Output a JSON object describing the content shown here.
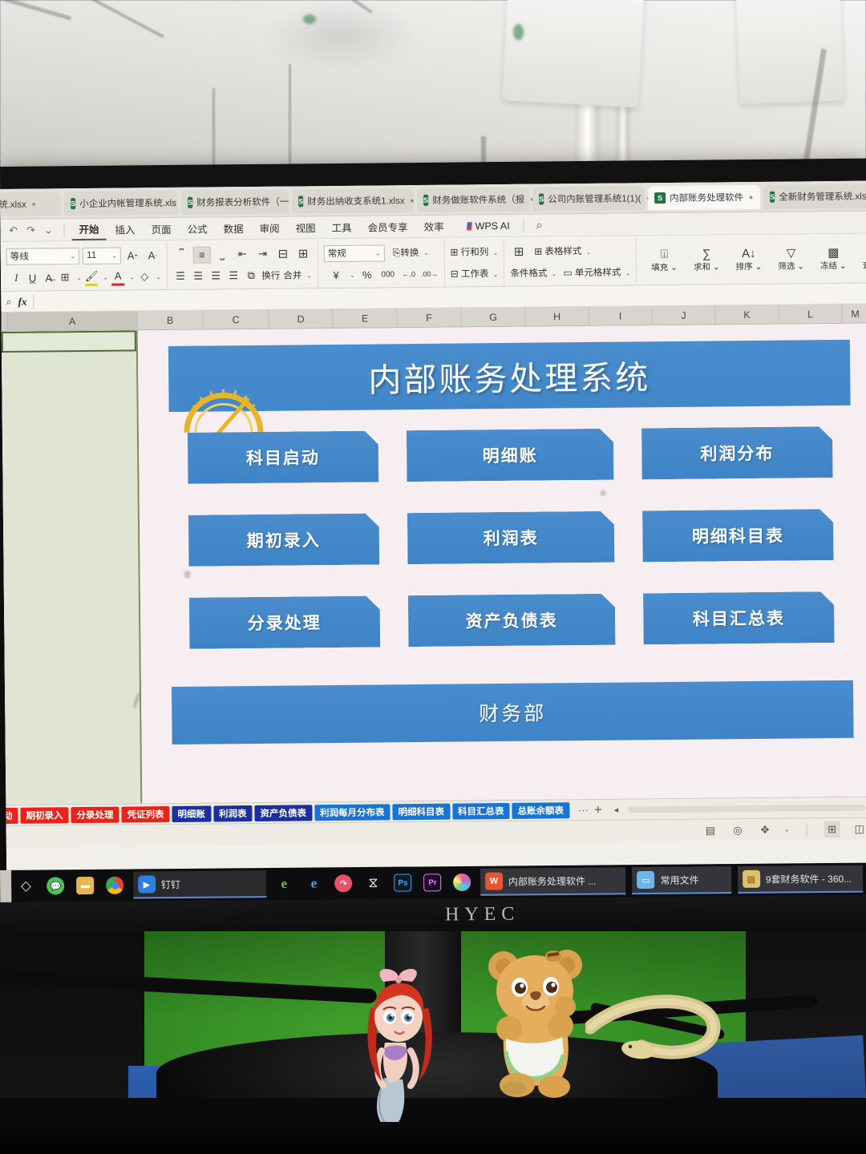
{
  "scene": {
    "monitor_brand": "HYEC",
    "photo_note": "photo of a monitor showing WPS Spreadsheet, toy figurines on desk"
  },
  "app": {
    "file_tabs": [
      {
        "label": "理系统.xlsx",
        "active": false,
        "icon": "excel-icon",
        "partial": true
      },
      {
        "label": "小企业内帐管理系统.xls",
        "active": false,
        "icon": "excel-icon"
      },
      {
        "label": "财务报表分析软件（一",
        "active": false,
        "icon": "excel-icon"
      },
      {
        "label": "财务出纳收支系统1.xlsx",
        "active": false,
        "icon": "excel-icon"
      },
      {
        "label": "财务做账软件系统（报",
        "active": false,
        "icon": "excel-icon"
      },
      {
        "label": "公司内账管理系统1(1)(",
        "active": false,
        "icon": "excel-icon"
      },
      {
        "label": "内部账务处理软件",
        "active": true,
        "icon": "excel-icon"
      },
      {
        "label": "全新财务管理系统.xlsm",
        "active": false,
        "icon": "excel-icon"
      }
    ],
    "menu": {
      "items": [
        {
          "label": "开始",
          "selected": true
        },
        {
          "label": "插入",
          "selected": false
        },
        {
          "label": "页面",
          "selected": false
        },
        {
          "label": "公式",
          "selected": false
        },
        {
          "label": "数据",
          "selected": false
        },
        {
          "label": "审阅",
          "selected": false
        },
        {
          "label": "视图",
          "selected": false
        },
        {
          "label": "工具",
          "selected": false
        },
        {
          "label": "会员专享",
          "selected": false
        },
        {
          "label": "效率",
          "selected": false
        }
      ],
      "ai_label": "WPS AI",
      "search_icon": "search-icon",
      "undo_icon": "undo-icon",
      "redo_icon": "redo-icon",
      "more_icon": "chevron-down-icon"
    },
    "ribbon": {
      "font": {
        "name": "等线",
        "size": "11",
        "grow_icon": "font-grow-icon",
        "shrink_icon": "font-shrink-icon"
      },
      "format_row2": [
        "italic-icon",
        "underline-icon",
        "strikethrough-icon",
        "borders-icon",
        "highlight-icon",
        "font-color-icon",
        "clear-format-icon"
      ],
      "align_top": [
        "align-top-icon",
        "align-middle-icon",
        "align-bottom-icon",
        "indent-decrease-icon",
        "indent-increase-icon",
        "orientation-icon",
        "merge-grid-icon"
      ],
      "align_bottom": [
        "align-left-icon",
        "align-center-icon",
        "align-right-icon",
        "justify-icon",
        "distribute-icon"
      ],
      "wrap_label": "换行",
      "merge_label": "合并",
      "number_format": "常规",
      "convert_label": "转换",
      "currency_icon": "currency-yuan-icon",
      "percent_icon": "percent-icon",
      "comma_icon": "comma-style-icon",
      "dec_decrease_icon": "decimal-decrease-icon",
      "dec_increase_icon": "decimal-increase-icon",
      "cells": [
        {
          "label": "行和列",
          "icon": "rows-columns-icon"
        },
        {
          "label": "工作表",
          "icon": "worksheet-icon"
        }
      ],
      "styles": [
        {
          "label": "条件格式",
          "icon": "conditional-format-icon"
        },
        {
          "label": "表格样式",
          "icon": "table-style-icon"
        },
        {
          "label": "单元格样式",
          "icon": "cell-style-icon"
        }
      ],
      "edit_tools": [
        {
          "label": "填充",
          "icon": "fill-icon"
        },
        {
          "label": "求和",
          "icon": "sum-icon"
        },
        {
          "label": "排序",
          "icon": "sort-icon"
        },
        {
          "label": "筛选",
          "icon": "filter-icon"
        },
        {
          "label": "冻结",
          "icon": "freeze-icon"
        },
        {
          "label": "查找",
          "icon": "search-icon"
        }
      ]
    },
    "formula_bar": {
      "name_box": "",
      "value": "",
      "fx_label": "fx",
      "zoom_icon": "search-icon"
    },
    "columns": [
      "A",
      "B",
      "C",
      "D",
      "E",
      "F",
      "G",
      "H",
      "I",
      "J",
      "K",
      "L",
      "M"
    ],
    "selected_column": "A",
    "sheet_tabs": [
      {
        "label": "启动",
        "color": "#e8231a",
        "partial": true
      },
      {
        "label": "期初录入",
        "color": "#e8231a"
      },
      {
        "label": "分录处理",
        "color": "#e8231a"
      },
      {
        "label": "凭证列表",
        "color": "#e8231a"
      },
      {
        "label": "明细账",
        "color": "#1b2f9e"
      },
      {
        "label": "利润表",
        "color": "#1b2f9e"
      },
      {
        "label": "资产负债表",
        "color": "#1b2f9e"
      },
      {
        "label": "利润每月分布表",
        "color": "#1874d2"
      },
      {
        "label": "明细科目表",
        "color": "#1874d2"
      },
      {
        "label": "科目汇总表",
        "color": "#1874d2"
      },
      {
        "label": "总账余额表",
        "color": "#1874d2"
      }
    ],
    "sheet_bar_tools": {
      "more": "···",
      "add": "+",
      "nav_prev": "◄"
    },
    "status_icons": [
      "page-layout-icon",
      "eye-icon",
      "accessibility-icon",
      "grid-view-icon",
      "split-view-icon"
    ]
  },
  "dashboard": {
    "title": "内部账务处理系统",
    "gauge_icon": "gauge-icon",
    "accent_color": "#4a8ccc",
    "panel_bg": "#f7eef2",
    "buttons": [
      [
        "科目启动",
        "明细账",
        "利润分布"
      ],
      [
        "期初录入",
        "利润表",
        "明细科目表"
      ],
      [
        "分录处理",
        "资产负债表",
        "科目汇总表"
      ]
    ],
    "footer": "财务部"
  },
  "taskbar": {
    "pinned": [
      {
        "name": "diamond-icon",
        "glyph": "◇",
        "color": "#d8d8d8",
        "bg": "transparent"
      },
      {
        "name": "wechat-icon",
        "glyph": "",
        "color": "#fff",
        "bg": "#4ec25a"
      },
      {
        "name": "folder-icon",
        "glyph": "",
        "color": "#fff",
        "bg": "#e8b552"
      },
      {
        "name": "chrome-icon",
        "glyph": "",
        "color": "#fff",
        "bg": "#4285f4"
      }
    ],
    "windows": [
      {
        "label": "钉钉",
        "icon": "dingtalk-icon",
        "bg": "#2e7ee0",
        "active": true
      },
      {
        "label": "内部账务处理软件 ...",
        "icon": "wps-icon",
        "bg": "#e8542f",
        "active": true
      },
      {
        "label": "常用文件",
        "icon": "folder-icon",
        "bg": "#6fb5e8",
        "active": true
      },
      {
        "label": "9套财务软件 - 360...",
        "icon": "archive-icon",
        "bg": "#e0c16a",
        "active": true
      }
    ],
    "tray_icons": [
      {
        "name": "edge-legacy-icon",
        "glyph": "e",
        "color": "#7bc043"
      },
      {
        "name": "internet-explorer-icon",
        "glyph": "e",
        "color": "#4aa8e0"
      },
      {
        "name": "recorder-icon",
        "glyph": "",
        "color": "#e8516a"
      },
      {
        "name": "meitu-icon",
        "glyph": "",
        "color": "#fff"
      },
      {
        "name": "photoshop-icon",
        "glyph": "Ps",
        "color": "#31a8ff"
      },
      {
        "name": "premiere-icon",
        "glyph": "Pr",
        "color": "#ea77ff"
      },
      {
        "name": "chrome-canary-icon",
        "glyph": "",
        "color": "#fff"
      }
    ]
  }
}
